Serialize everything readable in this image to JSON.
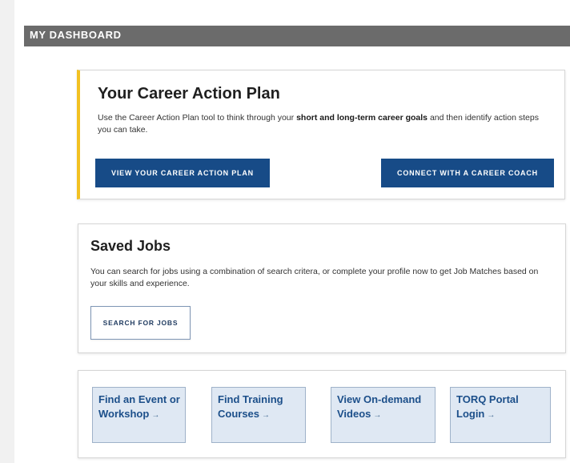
{
  "header": {
    "title": "MY DASHBOARD"
  },
  "career_plan": {
    "title": "Your Career Action Plan",
    "desc_before": "Use the Career Action Plan tool to think through your ",
    "desc_bold": "short and long-term career goals",
    "desc_after": " and then identify action steps you can take.",
    "primary_button": "VIEW YOUR CAREER ACTION PLAN",
    "secondary_button": "CONNECT WITH A CAREER COACH",
    "accent_color": "#f2c122",
    "button_color": "#174b87"
  },
  "saved_jobs": {
    "title": "Saved Jobs",
    "desc": "You can search for jobs using a combination of search critera, or complete your profile now to get Job Matches based on your skills and experience.",
    "button": "SEARCH FOR JOBS"
  },
  "quick_links": [
    {
      "label": "Find an Event or Workshop",
      "icon": "arrow-right-icon"
    },
    {
      "label": "Find Training Courses",
      "icon": "arrow-right-icon"
    },
    {
      "label": "View On-demand Videos",
      "icon": "arrow-right-icon"
    },
    {
      "label": "TORQ Portal Login",
      "icon": "arrow-right-icon"
    }
  ],
  "arrow_glyph": "→"
}
